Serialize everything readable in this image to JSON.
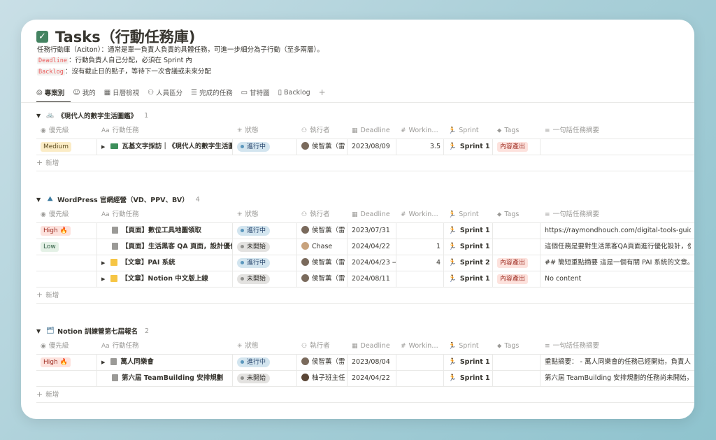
{
  "page": {
    "title": "Tasks（行動任務庫)",
    "desc_line1": "任務行動庫（Aciton）：通常是單一負責人負責的具體任務，可進一步細分為子行動（至多兩層）。",
    "desc_line2_code": "Deadline",
    "desc_line2_text": "：行動負責人自己分配，必須在 Sprint 內",
    "desc_line3_code": "Backlog",
    "desc_line3_text": "：沒有截止日的點子，等待下一次會議或未來分配"
  },
  "tabs": [
    {
      "label": "專案別",
      "icon": "target-icon"
    },
    {
      "label": "我的",
      "icon": "user-icon"
    },
    {
      "label": "日曆檢視",
      "icon": "calendar-icon"
    },
    {
      "label": "人員區分",
      "icon": "people-icon"
    },
    {
      "label": "完成的任務",
      "icon": "checklist-icon"
    },
    {
      "label": "甘特圖",
      "icon": "timeline-icon"
    },
    {
      "label": "Backlog",
      "icon": "book-icon"
    }
  ],
  "columns": {
    "priority": "優先級",
    "task": "行動任務",
    "status": "狀態",
    "assignee": "執行者",
    "deadline": "Deadline",
    "working": "Workin…",
    "sprint": "Sprint",
    "tags": "Tags",
    "summary": "一句話任務摘要"
  },
  "new_label": "新增",
  "groups": [
    {
      "name": "《現代人的數字生活圖鑑》",
      "count": "1",
      "icon_color": "#4f8bb5",
      "rows": [
        {
          "priority": "Medium",
          "priority_kind": "med",
          "has_toggle": true,
          "icon": "id-card-icon",
          "task": "瓦基文字採訪｜《現代人的數字生活圖",
          "status": "進行中",
          "status_kind": "prog",
          "assignee": "侯智薰（雷",
          "avatar": "a",
          "deadline": "2023/08/09",
          "working": "3.5",
          "sprint": "Sprint 1",
          "tag": "內容產出",
          "summary": ""
        }
      ]
    },
    {
      "name": "WordPress 官網經營（VD、PPV、BV）",
      "count": "4",
      "icon_color": "#3d7ca0",
      "rows": [
        {
          "priority": "High 🔥",
          "priority_kind": "high",
          "has_toggle": false,
          "icon": "doc-icon",
          "task": "【頁面】數位工具地圖領取",
          "status": "進行中",
          "status_kind": "prog",
          "assignee": "侯智薰（雷",
          "avatar": "a",
          "deadline": "2023/07/31",
          "working": "",
          "sprint": "Sprint 1",
          "tag": "",
          "summary": "https://raymondhouch.com/digital-tools-guide/"
        },
        {
          "priority": "Low",
          "priority_kind": "low",
          "has_toggle": false,
          "icon": "doc-icon",
          "task": "【頁面】生活黑客 QA 頁面，設計優化",
          "status": "未開始",
          "status_kind": "not",
          "assignee": "Chase",
          "avatar": "b",
          "deadline": "2024/04/22",
          "working": "1",
          "sprint": "Sprint 1",
          "tag": "",
          "summary": "這個任務是要對生活黑客QA頁面進行優化設計，使"
        },
        {
          "priority": "",
          "priority_kind": "",
          "has_toggle": true,
          "icon": "note-icon",
          "task": "【文章】PAI 系統",
          "status": "進行中",
          "status_kind": "prog",
          "assignee": "侯智薰（雷",
          "avatar": "a",
          "deadline": "2024/04/23 →",
          "working": "4",
          "sprint": "Sprint 2",
          "tag": "內容產出",
          "summary": "## 簡短重點摘要 這是一個有關 PAI 系統的文章。"
        },
        {
          "priority": "",
          "priority_kind": "",
          "has_toggle": true,
          "icon": "note-icon",
          "task": "【文章】Notion 中文版上線",
          "status": "未開始",
          "status_kind": "not",
          "assignee": "侯智薰（雷",
          "avatar": "a",
          "deadline": "2024/08/11",
          "working": "",
          "sprint": "Sprint 1",
          "tag": "內容產出",
          "summary": "No content"
        }
      ]
    },
    {
      "name": "Notion 訓練營第七屆報名",
      "count": "2",
      "icon_color": "#6a8fa8",
      "rows": [
        {
          "priority": "High 🔥",
          "priority_kind": "high",
          "has_toggle": true,
          "icon": "doc-icon",
          "task": "萬人同樂會",
          "status": "進行中",
          "status_kind": "prog",
          "assignee": "侯智薰（雷",
          "avatar": "a",
          "deadline": "2023/08/04",
          "working": "",
          "sprint": "Sprint 1",
          "tag": "",
          "summary": "重點摘要： - 萬人同樂會的任務已經開始，負責人"
        },
        {
          "priority": "",
          "priority_kind": "",
          "has_toggle": false,
          "icon": "doc-icon",
          "task": "第六屆 TeamBuilding 安排規劃",
          "status": "未開始",
          "status_kind": "not",
          "assignee": "柚子班主任",
          "avatar": "c",
          "deadline": "2024/04/22",
          "working": "",
          "sprint": "Sprint 1",
          "tag": "",
          "summary": "第六屆 TeamBuilding 安排規劃的任務尚未開始，"
        }
      ]
    }
  ]
}
